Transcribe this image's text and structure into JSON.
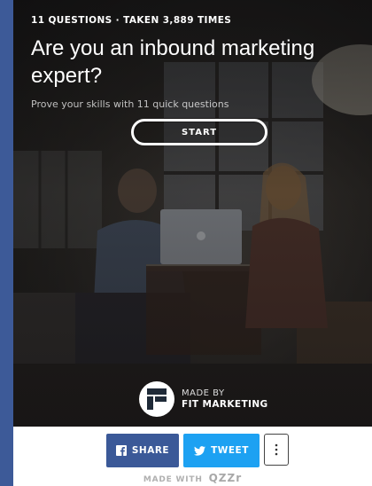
{
  "quiz": {
    "meta": "11 QUESTIONS · TAKEN 3,889 TIMES",
    "title": "Are you an inbound marketing expert?",
    "subtitle": "Prove your skills with 11 quick questions",
    "start_label": "START"
  },
  "brand": {
    "made_by": "MADE BY",
    "name": "FIT MARKETING",
    "logo_icon": "fit-marketing-logo-icon"
  },
  "share": {
    "facebook_label": "SHARE",
    "twitter_label": "TWEET",
    "more_icon": "vertical-ellipsis-icon",
    "facebook_color": "#3b5998",
    "twitter_color": "#1da1f2"
  },
  "footer": {
    "made_with": "MADE WITH",
    "platform": "QZZr"
  },
  "colors": {
    "page_background": "#3d5a98",
    "card_background": "#ffffff"
  }
}
